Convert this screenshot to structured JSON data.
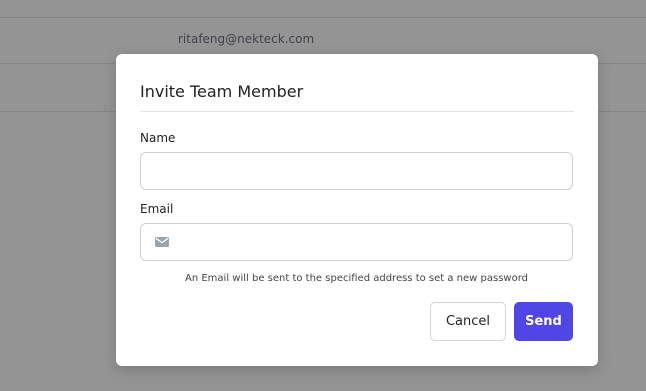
{
  "background": {
    "rows": [
      {
        "email": ""
      },
      {
        "email": "ritafeng@nekteck.com"
      },
      {
        "email": ""
      }
    ]
  },
  "modal": {
    "title": "Invite Team Member",
    "name_field": {
      "label": "Name",
      "value": "",
      "placeholder": ""
    },
    "email_field": {
      "label": "Email",
      "value": "",
      "placeholder": "",
      "icon": "mail-icon"
    },
    "help_text": "An Email will be sent to the specified address to set a new password",
    "buttons": {
      "cancel": "Cancel",
      "send": "Send"
    }
  },
  "colors": {
    "primary": "#4f46e5",
    "overlay": "rgba(0,0,0,0.42)"
  }
}
